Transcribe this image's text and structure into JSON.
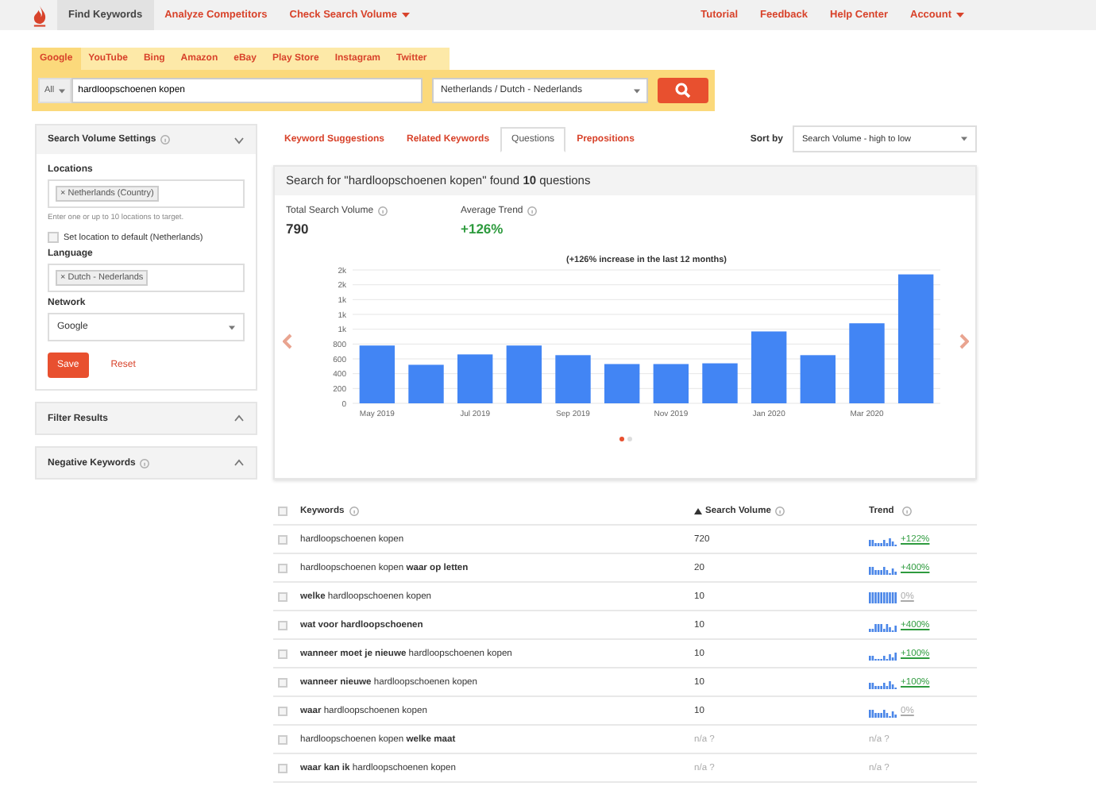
{
  "nav": {
    "items": [
      {
        "label": "Find Keywords",
        "selected": true,
        "dropdown": false
      },
      {
        "label": "Analyze Competitors",
        "selected": false,
        "dropdown": false
      },
      {
        "label": "Check Search Volume",
        "selected": false,
        "dropdown": true
      }
    ],
    "right": [
      {
        "label": "Tutorial",
        "dropdown": false
      },
      {
        "label": "Feedback",
        "dropdown": false
      },
      {
        "label": "Help Center",
        "dropdown": false
      },
      {
        "label": "Account",
        "dropdown": true
      }
    ]
  },
  "sources": [
    {
      "label": "Google",
      "selected": true
    },
    {
      "label": "YouTube",
      "selected": false
    },
    {
      "label": "Bing",
      "selected": false
    },
    {
      "label": "Amazon",
      "selected": false
    },
    {
      "label": "eBay",
      "selected": false
    },
    {
      "label": "Play Store",
      "selected": false
    },
    {
      "label": "Instagram",
      "selected": false
    },
    {
      "label": "Twitter",
      "selected": false
    }
  ],
  "search": {
    "scope": "All",
    "value": "hardloopschoenen kopen",
    "location": "Netherlands / Dutch - Nederlands"
  },
  "sidebar": {
    "settings": {
      "title": "Search Volume Settings",
      "expanded": true,
      "locations_label": "Locations",
      "location_tag": "× Netherlands (Country)",
      "location_hint": "Enter one or up to 10 locations to target.",
      "default_label": "Set location to default (Netherlands)",
      "default_checked": false,
      "language_label": "Language",
      "language_tag": "× Dutch - Nederlands",
      "network_label": "Network",
      "network": "Google",
      "save": "Save",
      "reset": "Reset"
    },
    "panels": [
      {
        "title": "Filter Results",
        "info": false,
        "expanded": false
      },
      {
        "title": "Negative Keywords",
        "info": true,
        "expanded": false
      }
    ]
  },
  "tabs": [
    {
      "label": "Keyword Suggestions",
      "selected": false
    },
    {
      "label": "Related Keywords",
      "selected": false
    },
    {
      "label": "Questions",
      "selected": true
    },
    {
      "label": "Prepositions",
      "selected": false
    }
  ],
  "sort": {
    "label": "Sort by",
    "value": "Search Volume - high to low"
  },
  "summary": {
    "title": "Search for \"hardloopschoenen kopen\" found **10** questions",
    "total_label": "Total Search Volume",
    "total": "790",
    "trend_label": "Average Trend",
    "trend": "+126%",
    "chart_data": {
      "type": "bar",
      "title": "(+126% increase in the last 12 months)",
      "categories": [
        "May 2019",
        null,
        "Jul 2019",
        null,
        "Sep 2019",
        null,
        "Nov 2019",
        null,
        "Jan 2020",
        null,
        "Mar 2020",
        null
      ],
      "values": [
        780,
        520,
        660,
        780,
        650,
        530,
        530,
        540,
        970,
        650,
        1080,
        1740
      ],
      "grid": true,
      "ylim": [
        0,
        1800
      ],
      "yticks": [
        0,
        200,
        400,
        600,
        800,
        {
          "value": 1000,
          "label": "1k"
        },
        {
          "value": 1200,
          "label": "1k"
        },
        {
          "value": 1400,
          "label": "1k"
        },
        {
          "value": 1600,
          "label": "2k"
        },
        {
          "value": 1800,
          "label": "2k"
        }
      ]
    },
    "pages": [
      {
        "selected": true
      },
      {
        "selected": false
      }
    ]
  },
  "table": {
    "columns": [
      "Keywords",
      "Search Volume",
      "Trend"
    ],
    "all_checked": false,
    "rows": [
      {
        "keyword": "hardloopschoenen kopen",
        "volume": "720",
        "trend": "+122%",
        "kind": "up",
        "checked": false
      },
      {
        "keyword": "hardloopschoenen kopen **waar op letten**",
        "volume": "20",
        "trend": "+400%",
        "kind": "up",
        "checked": false
      },
      {
        "keyword": "**welke** hardloopschoenen kopen",
        "volume": "10",
        "trend": "0%",
        "kind": "flat",
        "checked": false
      },
      {
        "keyword": "**wat voor hardloopschoenen**",
        "volume": "10",
        "trend": "+400%",
        "kind": "up",
        "checked": false
      },
      {
        "keyword": "**wanneer moet je nieuwe** hardloopschoenen kopen",
        "volume": "10",
        "trend": "+100%",
        "kind": "up",
        "checked": false
      },
      {
        "keyword": "**wanneer nieuwe** hardloopschoenen kopen",
        "volume": "10",
        "trend": "+100%",
        "kind": "up",
        "checked": false
      },
      {
        "keyword": "**waar** hardloopschoenen kopen",
        "volume": "10",
        "trend": "0%",
        "kind": "flat",
        "checked": false
      },
      {
        "keyword": "hardloopschoenen kopen **welke maat**",
        "volume": "n/a ?",
        "trend": "n/a ?",
        "kind": "na",
        "checked": false
      },
      {
        "keyword": "**waar kan ik** hardloopschoenen kopen",
        "volume": "n/a ?",
        "trend": "n/a ?",
        "kind": "na",
        "checked": false
      }
    ]
  }
}
